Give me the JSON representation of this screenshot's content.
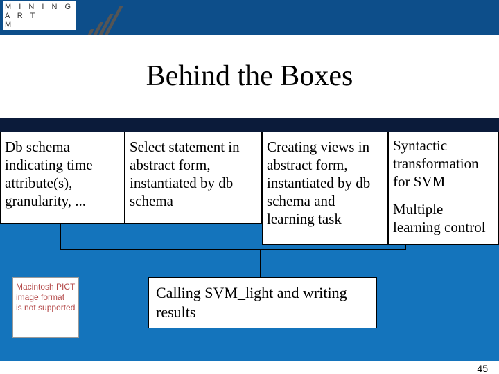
{
  "logo": {
    "line1": "M I N I N G",
    "line2": "A R T",
    "line3": "M"
  },
  "title": "Behind the Boxes",
  "boxes": {
    "b1": "Db schema indicating time attribute(s), granularity, ...",
    "b2": "Select statement in abstract form, instantiated by db schema",
    "b3": "Creating views in abstract form, instantiated by db schema and learning task",
    "b4a": "Syntactic transformation for SVM",
    "b4b": "Multiple learning control"
  },
  "callbox": "Calling SVM_light and writing results",
  "pict": {
    "l1": "Macintosh PICT",
    "l2": "image format",
    "l3": "is not supported"
  },
  "page_number": "45"
}
